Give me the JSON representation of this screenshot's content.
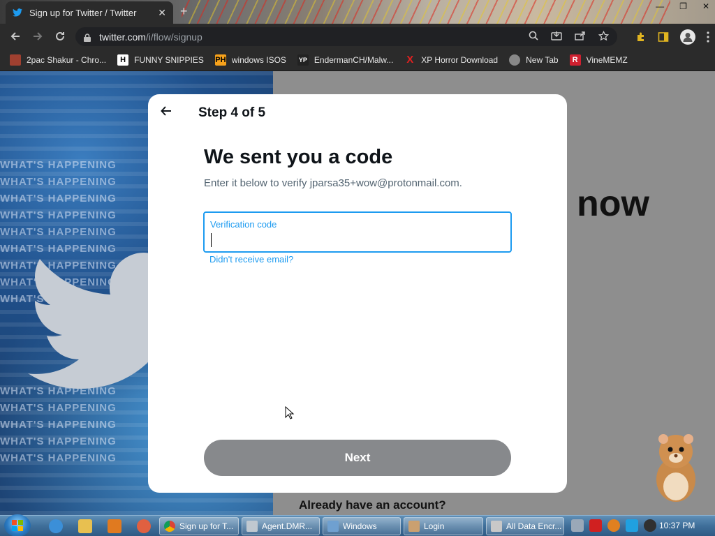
{
  "browser": {
    "tab_title": "Sign up for Twitter / Twitter",
    "tab_close": "✕",
    "new_tab": "+",
    "url_domain": "twitter.com",
    "url_path": "/i/flow/signup",
    "bookmarks": [
      {
        "label": "2pac Shakur - Chro...",
        "icon": "2pac-icon"
      },
      {
        "label": "FUNNY SNIPPIES",
        "icon": "H"
      },
      {
        "label": "windows ISOS",
        "icon": "PH"
      },
      {
        "label": "EndermanCH/Malw...",
        "icon": "YP"
      },
      {
        "label": "XP Horror Download",
        "icon": "X"
      },
      {
        "label": "New Tab",
        "icon": "globe-icon"
      },
      {
        "label": "VineMEMZ",
        "icon": "R"
      }
    ]
  },
  "page": {
    "background_word": "now",
    "already_account": "Already have an account?",
    "art_text": "WHAT'S HAPPENING"
  },
  "modal": {
    "step": "Step 4 of 5",
    "heading": "We sent you a code",
    "subtitle": "Enter it below to verify jparsa35+wow@protonmail.com.",
    "field_label": "Verification code",
    "field_value": "",
    "didnt_receive": "Didn't receive email?",
    "next_label": "Next"
  },
  "taskbar": {
    "windows": [
      {
        "label": "Sign up for T...",
        "icon_color": "#d9d9d9"
      },
      {
        "label": "Agent.DMR...",
        "icon_color": "#c0c8d0"
      },
      {
        "label": "Windows",
        "icon_color": "#6fa0d0"
      },
      {
        "label": "Login",
        "icon_color": "#caa070"
      },
      {
        "label": "All Data Encr...",
        "icon_color": "#c8c8c8"
      }
    ],
    "clock": "10:37 PM"
  },
  "colors": {
    "accent": "#1d9bf0",
    "next_bg": "#87898c",
    "chrome_bg": "#2b2b2b"
  }
}
